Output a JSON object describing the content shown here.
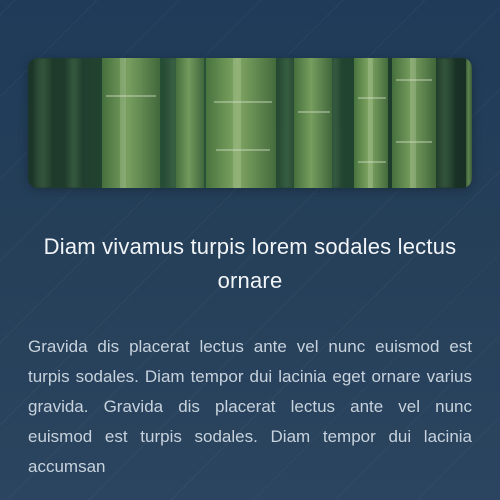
{
  "hero": {
    "image_alt": "Bamboo stalks photo"
  },
  "content": {
    "title": "Diam vivamus turpis lorem sodales lectus ornare",
    "body": "Gravida dis placerat lectus ante vel nunc euismod est turpis sodales. Diam tempor dui lacinia eget ornare varius gravida. Gravida dis placerat lectus ante vel nunc euismod est turpis sodales. Diam tempor dui lacinia accumsan"
  },
  "colors": {
    "background_top": "#1f3b59",
    "background_bottom": "#2b4560",
    "title_text": "#f2f5f8",
    "body_text": "#c7d2dc",
    "bamboo_green": "#6f9b57"
  }
}
